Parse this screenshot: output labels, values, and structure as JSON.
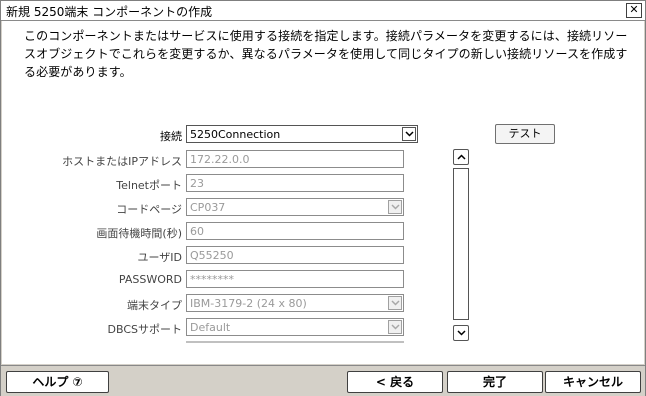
{
  "window": {
    "title": "新規 5250端末 コンポーネントの作成",
    "close_glyph": "✕"
  },
  "description": "このコンポーネントまたはサービスに使用する接続を指定します。接続パラメータを変更するには、接続リソースオブジェクトでこれらを変更するか、異なるパラメータを使用して同じタイプの新しい接続リソースを作成する必要があります。",
  "connection": {
    "label": "接続",
    "value": "5250Connection"
  },
  "test_button": "テスト",
  "fields": [
    {
      "label": "ホストまたはIPアドレス",
      "value": "172.22.0.0",
      "type": "text"
    },
    {
      "label": "Telnetポート",
      "value": "23",
      "type": "text"
    },
    {
      "label": "コードページ",
      "value": "CP037",
      "type": "select"
    },
    {
      "label": "画面待機時間(秒)",
      "value": "60",
      "type": "text"
    },
    {
      "label": "ユーザID",
      "value": "Q55250",
      "type": "text"
    },
    {
      "label": "PASSWORD",
      "value": "********",
      "type": "text"
    },
    {
      "label": "端末タイプ",
      "value": "IBM-3179-2 (24 x 80)",
      "type": "select"
    },
    {
      "label": "DBCSサポート",
      "value": "Default",
      "type": "select"
    }
  ],
  "footer": {
    "help": "ヘルプ ⑦",
    "back": "< 戻る",
    "finish": "完了",
    "cancel": "キャンセル"
  }
}
